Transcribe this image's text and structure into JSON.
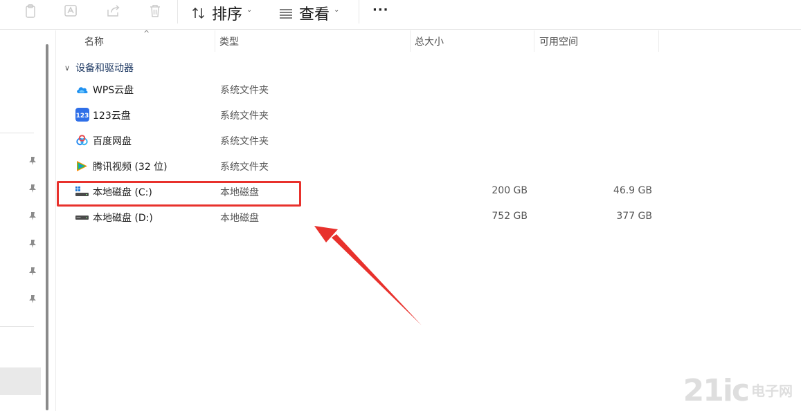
{
  "toolbar": {
    "icons": [
      "copy-icon",
      "rename-icon",
      "share-icon",
      "delete-icon"
    ],
    "sort_label": "排序",
    "view_label": "查看",
    "more_label": "···"
  },
  "columns": {
    "name": "名称",
    "type": "类型",
    "total": "总大小",
    "free": "可用空间"
  },
  "group": {
    "label": "设备和驱动器"
  },
  "items": [
    {
      "name": "WPS云盘",
      "type": "系统文件夹",
      "total": "",
      "free": "",
      "icon": "wps-cloud-icon"
    },
    {
      "name": "123云盘",
      "type": "系统文件夹",
      "total": "",
      "free": "",
      "icon": "123-cloud-icon"
    },
    {
      "name": "百度网盘",
      "type": "系统文件夹",
      "total": "",
      "free": "",
      "icon": "baidu-netdisk-icon"
    },
    {
      "name": "腾讯视频 (32 位)",
      "type": "系统文件夹",
      "total": "",
      "free": "",
      "icon": "tencent-video-icon"
    },
    {
      "name": "本地磁盘 (C:)",
      "type": "本地磁盘",
      "total": "200 GB",
      "free": "46.9 GB",
      "icon": "windows-drive-icon"
    },
    {
      "name": "本地磁盘 (D:)",
      "type": "本地磁盘",
      "total": "752 GB",
      "free": "377 GB",
      "icon": "drive-icon"
    }
  ],
  "watermark": {
    "number": "21ic",
    "text": "电子网"
  },
  "colors": {
    "annotation": "#e8312c",
    "group_header": "#1f3a64",
    "watermark": "#d9d9d9"
  }
}
